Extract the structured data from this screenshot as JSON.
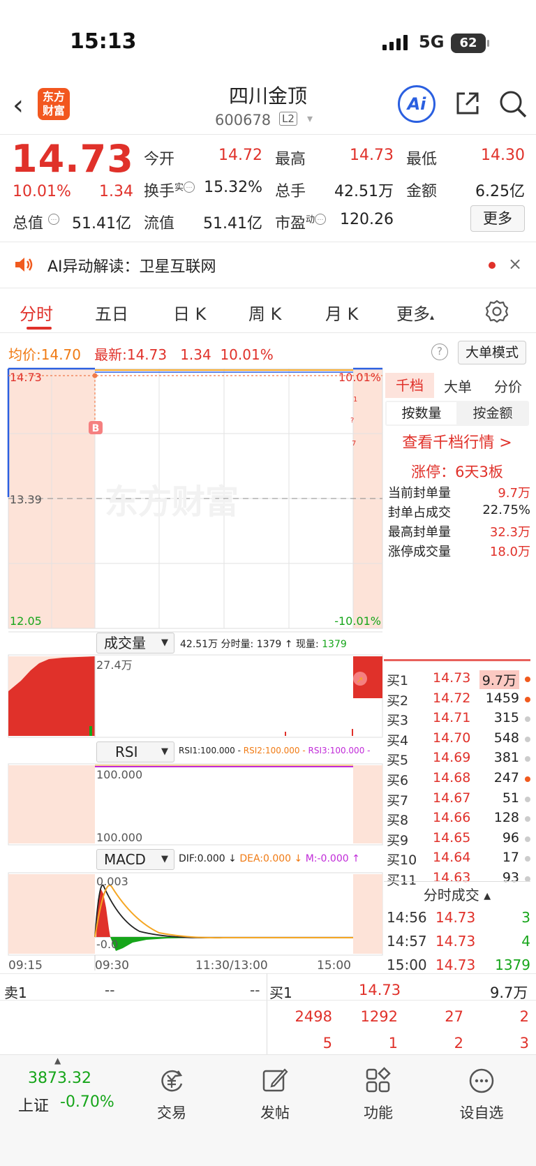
{
  "status": {
    "time": "15:13",
    "network": "5G",
    "battery": "62"
  },
  "header": {
    "logo": "东方\n财富",
    "title": "四川金顶",
    "code": "600678",
    "level": "L2",
    "ai": "Ai"
  },
  "quote": {
    "price": "14.73",
    "pct": "10.01%",
    "change": "1.34",
    "fields": [
      {
        "label": "今开",
        "value": "14.72",
        "color": "red"
      },
      {
        "label": "最高",
        "value": "14.73",
        "color": "red"
      },
      {
        "label": "最低",
        "value": "14.30",
        "color": "red"
      },
      {
        "label": "换手",
        "sup": "实",
        "value": "15.32%",
        "color": "black"
      },
      {
        "label": "总手",
        "value": "42.51万",
        "color": "black"
      },
      {
        "label": "金额",
        "value": "6.25亿",
        "color": "black"
      },
      {
        "label": "总值",
        "value": "51.41亿",
        "color": "black"
      },
      {
        "label": "流值",
        "value": "51.41亿",
        "color": "black"
      },
      {
        "label": "市盈",
        "sup": "动",
        "value": "120.26",
        "color": "black"
      }
    ],
    "more": "更多"
  },
  "ai_banner": {
    "text": "AI异动解读：卫星互联网",
    "close": "×"
  },
  "tabs": [
    "分时",
    "五日",
    "日 K",
    "周 K",
    "月 K",
    "更多"
  ],
  "avgline": {
    "avg_label": "均价:",
    "avg": "14.70",
    "last_label": "最新:",
    "last": "14.73",
    "chg": "1.34",
    "pct": "10.01%",
    "mode_btn": "大单模式",
    "help": "?"
  },
  "chart": {
    "price_top": "14.73",
    "pct_top": "10.01%",
    "price_mid": "13.39",
    "price_bot": "12.05",
    "pct_bot": "-10.01%",
    "marker": "B",
    "watermark": "东方财富",
    "vol": {
      "select": "成交量",
      "info": "42.51万 分时量: 1379 ↑ 现量: ",
      "now": "1379",
      "axis": "27.4万"
    },
    "rsi": {
      "select": "RSI",
      "r1": "RSI1:100.000 - ",
      "r2": "RSI2:100.000 - ",
      "r3": "RSI3:100.000 -",
      "top": "100.000",
      "bot": "100.000"
    },
    "macd": {
      "select": "MACD",
      "dif": "DIF:0.000 ↓ ",
      "dea": "DEA:0.000 ↓ ",
      "m": "M:-0.000 ↑",
      "top": "0.003",
      "bot": "-0.0"
    },
    "time_axis": [
      "09:15",
      "09:30",
      "11:30/13:00",
      "15:00"
    ],
    "colors": {
      "up": "#e0312a",
      "down": "#16a51a",
      "avg": "#f5a623",
      "bg_pre": "#fde3d8",
      "rsi3": "#c02ad8"
    }
  },
  "right_panel": {
    "tabs": [
      "千档",
      "大单",
      "分价"
    ],
    "seg": [
      "按数量",
      "按金额"
    ],
    "link": "查看千档行情 >",
    "limit": "涨停：6天3板",
    "stats": [
      {
        "label": "当前封单量",
        "value": "9.7万"
      },
      {
        "label": "封单占成交",
        "value": "22.75%"
      },
      {
        "label": "最高封单量",
        "value": "32.3万"
      },
      {
        "label": "涨停成交量",
        "value": "18.0万"
      }
    ],
    "orderbook": [
      {
        "label": "买1",
        "price": "14.73",
        "vol": "9.7万",
        "dot": "#f05a1e"
      },
      {
        "label": "买2",
        "price": "14.72",
        "vol": "1459",
        "dot": "#f05a1e"
      },
      {
        "label": "买3",
        "price": "14.71",
        "vol": "315",
        "dot": "#ccc"
      },
      {
        "label": "买4",
        "price": "14.70",
        "vol": "548",
        "dot": "#ccc"
      },
      {
        "label": "买5",
        "price": "14.69",
        "vol": "381",
        "dot": "#ccc"
      },
      {
        "label": "买6",
        "price": "14.68",
        "vol": "247",
        "dot": "#f05a1e"
      },
      {
        "label": "买7",
        "price": "14.67",
        "vol": "51",
        "dot": "#ccc"
      },
      {
        "label": "买8",
        "price": "14.66",
        "vol": "128",
        "dot": "#ccc"
      },
      {
        "label": "买9",
        "price": "14.65",
        "vol": "96",
        "dot": "#ccc"
      },
      {
        "label": "买10",
        "price": "14.64",
        "vol": "17",
        "dot": "#ccc"
      },
      {
        "label": "买11",
        "price": "14.63",
        "vol": "93",
        "dot": "#ccc"
      }
    ],
    "ticks_header": "分时成交 ▴",
    "ticks": [
      {
        "time": "14:56",
        "price": "14.73",
        "vol": "3"
      },
      {
        "time": "14:57",
        "price": "14.73",
        "vol": "4"
      },
      {
        "time": "15:00",
        "price": "14.73",
        "vol": "1379"
      }
    ]
  },
  "bottom_book": {
    "sell1_label": "卖1",
    "sell1_price": "--",
    "sell1_vol": "--",
    "buy1_label": "买1",
    "buy1_price": "14.73",
    "buy1_vol": "9.7万",
    "row2": [
      "2498",
      "1292",
      "27",
      "2"
    ],
    "row3": [
      "5",
      "1",
      "2",
      "3"
    ]
  },
  "tabbar": {
    "index_value": "3873.32",
    "index_name": "上证",
    "index_pct": "-0.70%",
    "items": [
      "交易",
      "发帖",
      "功能",
      "设自选"
    ]
  }
}
